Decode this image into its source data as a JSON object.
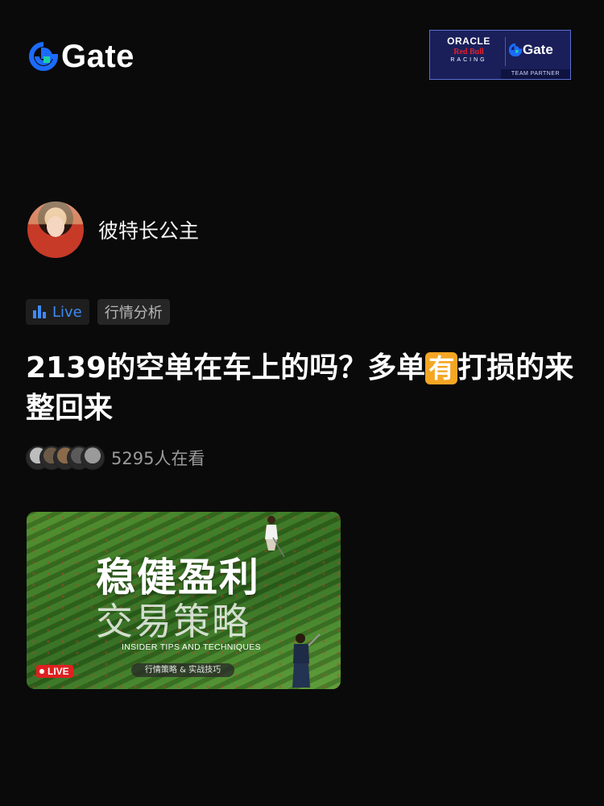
{
  "header": {
    "logo_text": "Gate",
    "brand_color": "#1c6bff",
    "partner": {
      "oracle": "ORACLE",
      "redbull": "Red Bull",
      "racing": "RACING",
      "gate": "Gate",
      "team_partner": "TEAM PARTNER"
    }
  },
  "author": {
    "name": "彼特长公主",
    "avatar_icon": "avatar-portrait-icon"
  },
  "tags": {
    "live_label": "Live",
    "category_label": "行情分析"
  },
  "post": {
    "title_part1": "2139的空单在车上的吗？多单",
    "title_emoji": "有",
    "title_part2": "打损的来整回来"
  },
  "viewers": {
    "count_text": "5295人在看",
    "avatar_colors": [
      "#bdbdbd",
      "#6b5a48",
      "#8a6a4a",
      "#5a5a5a",
      "#9a9a9a"
    ]
  },
  "cover": {
    "headline": "稳健盈利",
    "headline2": "交易策略",
    "subtitle": "INSIDER TIPS AND TECHNIQUES",
    "pill_text": "行情策略 & 实战技巧",
    "live_badge": "LIVE"
  }
}
